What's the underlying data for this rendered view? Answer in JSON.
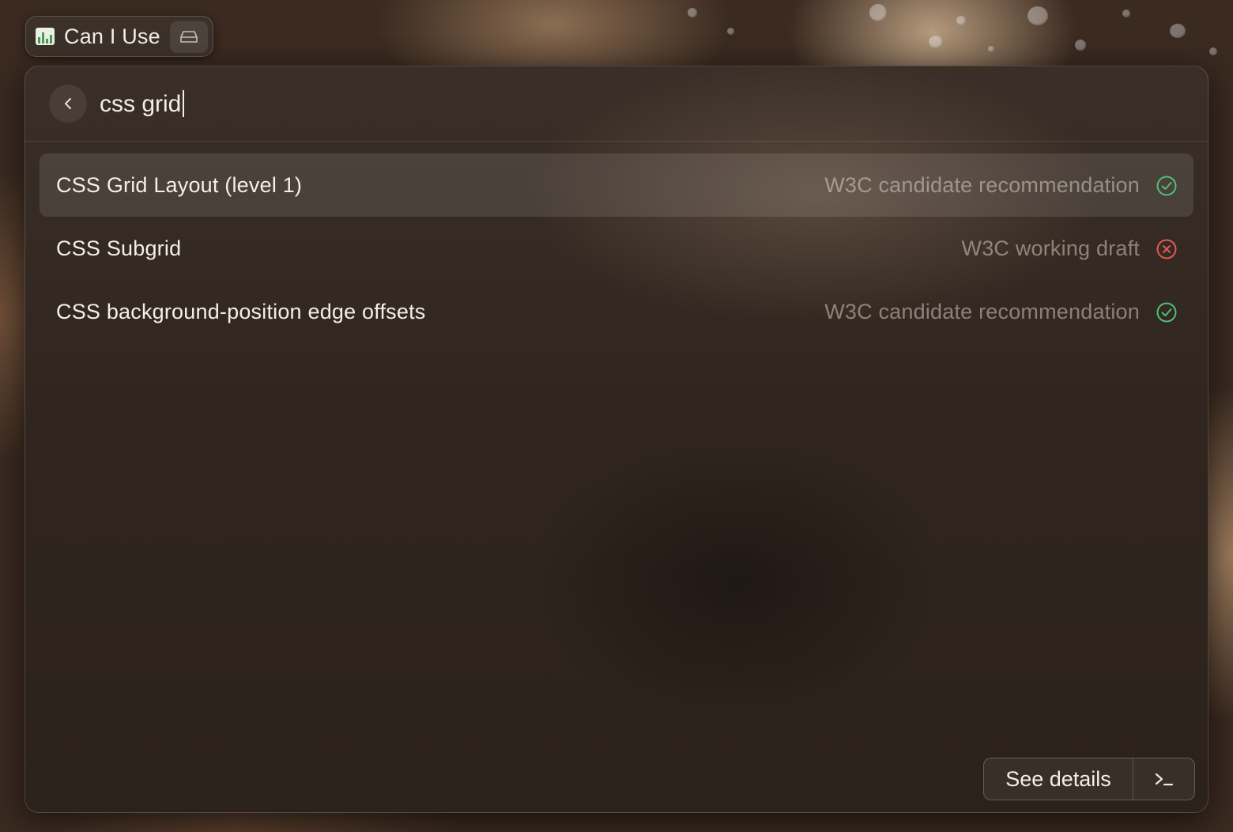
{
  "extension": {
    "title": "Can I Use",
    "icon": "chart-logo-icon",
    "secondary_icon": "drive-icon"
  },
  "search": {
    "value": "css grid",
    "back_icon": "chevron-left-icon"
  },
  "results": [
    {
      "title": "CSS Grid Layout (level 1)",
      "status": "W3C candidate recommendation",
      "status_icon": "check-circle-icon",
      "status_color": "#4fbf76",
      "selected": true
    },
    {
      "title": "CSS Subgrid",
      "status": "W3C working draft",
      "status_icon": "x-circle-icon",
      "status_color": "#e05a55",
      "selected": false
    },
    {
      "title": "CSS background-position edge offsets",
      "status": "W3C candidate recommendation",
      "status_icon": "check-circle-icon",
      "status_color": "#4fbf76",
      "selected": false
    }
  ],
  "action_bar": {
    "primary_label": "See details",
    "secondary_icon": "terminal-icon"
  }
}
